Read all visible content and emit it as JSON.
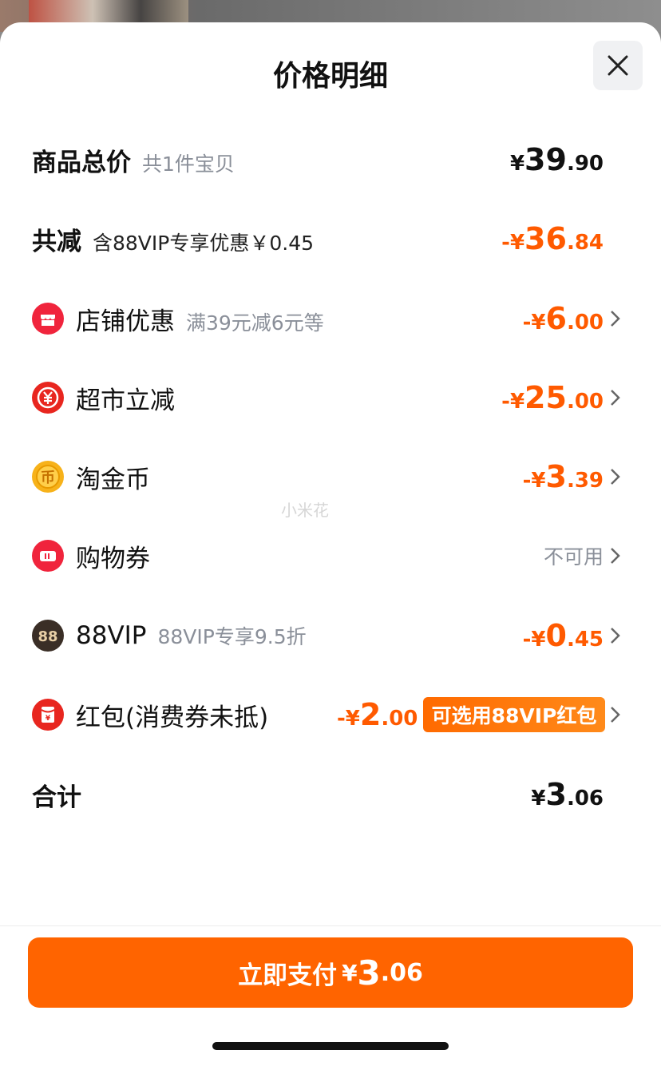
{
  "title": "价格明细",
  "goods_total": {
    "label": "商品总价",
    "sub": "共1件宝贝",
    "sym": "¥",
    "int": "39",
    "dec": ".90"
  },
  "total_reduce": {
    "label": "共减",
    "sub": "含88VIP专享优惠￥0.45",
    "sym": "-¥",
    "int": "36",
    "dec": ".84"
  },
  "items": [
    {
      "label": "店铺优惠",
      "sub": "满39元减6元等",
      "sym": "-¥",
      "int": "6",
      "dec": ".00",
      "icon": "shop-icon"
    },
    {
      "label": "超市立减",
      "sub": "",
      "sym": "-¥",
      "int": "25",
      "dec": ".00",
      "icon": "supermarket-yuan-icon"
    },
    {
      "label": "淘金币",
      "sub": "",
      "sym": "-¥",
      "int": "3",
      "dec": ".39",
      "icon": "coin-icon"
    },
    {
      "label": "购物券",
      "sub": "",
      "status": "不可用",
      "icon": "coupon-icon"
    },
    {
      "label": "88VIP",
      "sub": "88VIP专享9.5折",
      "sym": "-¥",
      "int": "0",
      "dec": ".45",
      "icon": "vip88-icon"
    }
  ],
  "red_packet": {
    "label": "红包(消费券未抵)",
    "sym": "-¥",
    "int": "2",
    "dec": ".00",
    "badge": "可选用88VIP红包",
    "icon": "red-packet-icon"
  },
  "subtotal": {
    "label": "合计",
    "sym": "¥",
    "int": "3",
    "dec": ".06"
  },
  "watermark": "小米花",
  "pay_button": {
    "label": "立即支付",
    "sym": "¥",
    "int": "3",
    "dec": ".06"
  },
  "colors": {
    "accent": "#ff5a00",
    "button": "#ff6400"
  }
}
